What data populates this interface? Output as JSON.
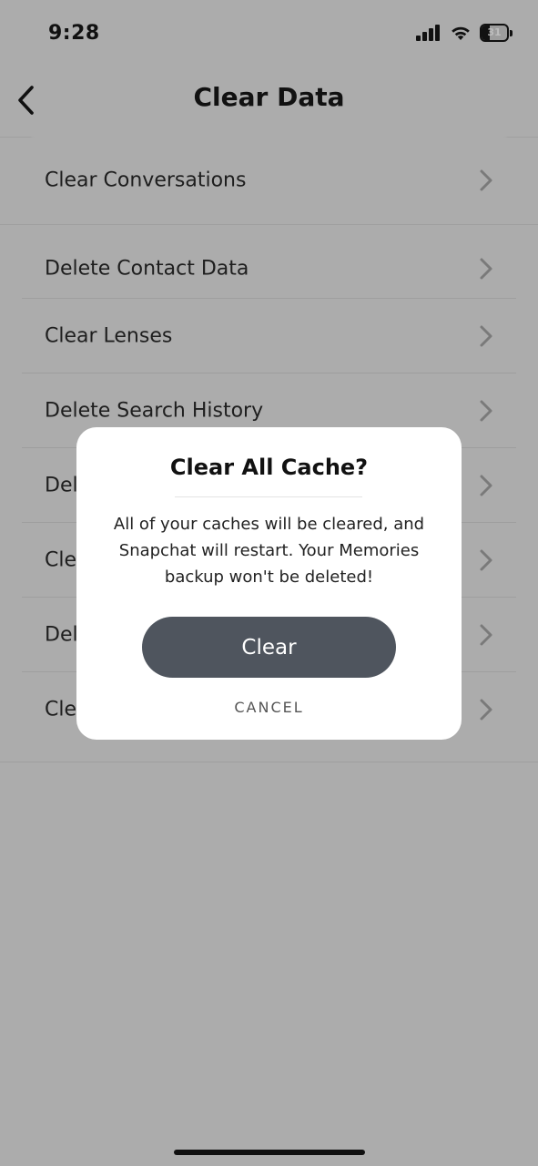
{
  "status_bar": {
    "time": "9:28",
    "battery_level": "31",
    "battery_fraction": 0.31,
    "icons": [
      "signal-icon",
      "wifi-icon",
      "battery-icon"
    ]
  },
  "header": {
    "title": "Clear Data",
    "back_icon": "chevron-left-icon"
  },
  "lists": {
    "group1": [
      {
        "label": "Clear Conversations"
      }
    ],
    "group2": [
      {
        "label": "Delete Contact Data"
      },
      {
        "label": "Clear Lenses"
      },
      {
        "label": "Delete Search History"
      },
      {
        "label": "Del"
      },
      {
        "label": "Cle"
      },
      {
        "label": "Del"
      },
      {
        "label": "Cle"
      }
    ]
  },
  "modal": {
    "title": "Clear All Cache?",
    "body_line1": "All of your caches will be cleared, and",
    "body_line2": "Snapchat will restart. Your Memories",
    "body_line3": "backup won't be deleted!",
    "confirm_label": "Clear",
    "cancel_label": "CANCEL"
  },
  "colors": {
    "background_dimmed": "#acacac",
    "modal_background": "#ffffff",
    "primary_button": "#4f555e"
  }
}
